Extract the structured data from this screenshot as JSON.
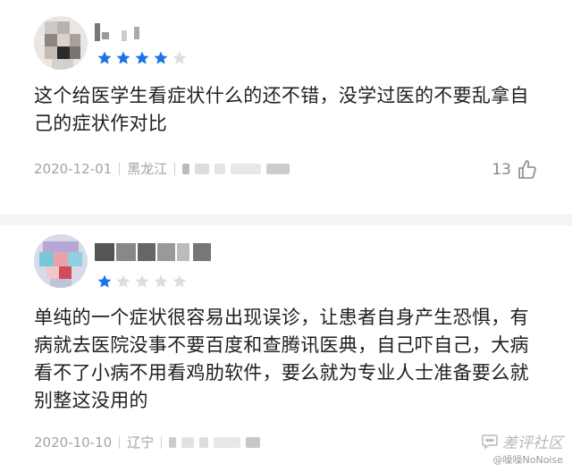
{
  "reviews": [
    {
      "rating": 4,
      "max_rating": 5,
      "text": "这个给医学生看症状什么的还不错，没学过医的不要乱拿自己的症状作对比",
      "date": "2020-12-01",
      "location": "黑龙江",
      "likes": "13"
    },
    {
      "rating": 1,
      "max_rating": 5,
      "text": "单纯的一个症状很容易出现误诊，让患者自身产生恐惧，有病就去医院没事不要百度和查腾讯医典，自己吓自己，大病看不了小病不用看鸡肋软件，要么就为专业人士准备要么就别整这没用的",
      "date": "2020-10-10",
      "location": "辽宁"
    }
  ],
  "watermark": {
    "title": "差评社区",
    "handle": "@噪噪NoNoise"
  },
  "colors": {
    "star_filled": "#1a73e8",
    "star_empty": "#dddddd",
    "meta_text": "#a3a3a3"
  }
}
